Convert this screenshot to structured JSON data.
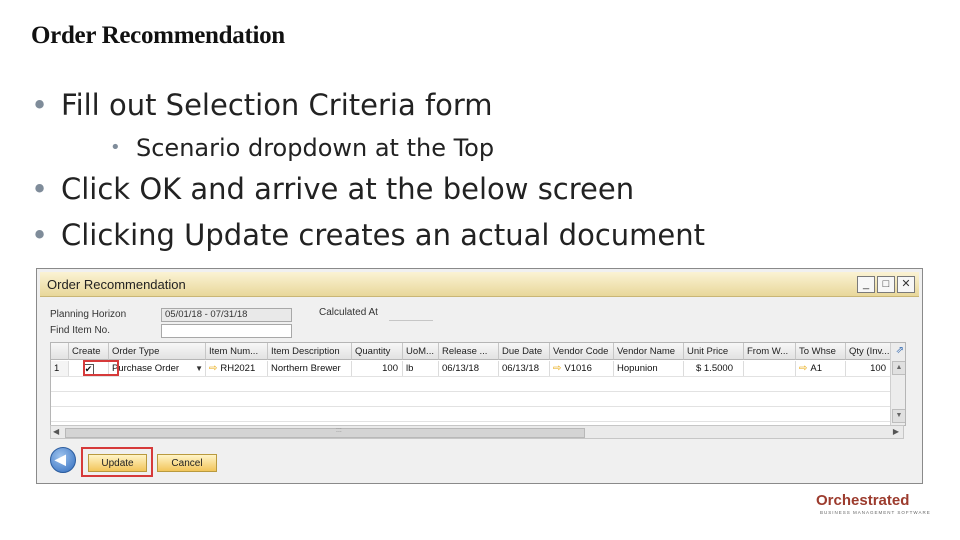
{
  "slide": {
    "title": "Order Recommendation",
    "bullets": [
      "Fill out Selection Criteria form",
      "Scenario dropdown at the Top",
      "Click OK and arrive at the below screen",
      "Clicking Update creates an actual document"
    ]
  },
  "window": {
    "title": "Order Recommendation",
    "controls": {
      "minimize": "_",
      "maximize": "□",
      "close": "✕"
    },
    "form": {
      "planning_horizon_label": "Planning Horizon",
      "planning_horizon_value": "05/01/18 - 07/31/18",
      "find_item_label": "Find Item No.",
      "find_item_value": "",
      "calculated_at_label": "Calculated At"
    },
    "grid": {
      "columns": [
        "",
        "Create",
        "Order Type",
        "Item Num...",
        "Item Description",
        "Quantity",
        "UoM...",
        "Release ...",
        "Due Date",
        "Vendor Code",
        "Vendor Name",
        "Unit Price",
        "From W...",
        "To Whse",
        "Qty (Inv..."
      ],
      "rows": [
        {
          "num": "1",
          "create": "✔",
          "order_type": "Purchase Order",
          "item_num": "RH2021",
          "item_description": "Northern Brewer",
          "quantity": "100",
          "uom": "lb",
          "release": "06/13/18",
          "due_date": "06/13/18",
          "vendor_code": "V1016",
          "vendor_name": "Hopunion",
          "unit_price": "$ 1.5000",
          "from_whse": "",
          "to_whse": "A1",
          "qty_inv": "100"
        }
      ]
    },
    "buttons": {
      "update": "Update",
      "cancel": "Cancel"
    }
  },
  "logo": {
    "name": "Orchestrated",
    "tagline": "BUSINESS MANAGEMENT SOFTWARE"
  }
}
